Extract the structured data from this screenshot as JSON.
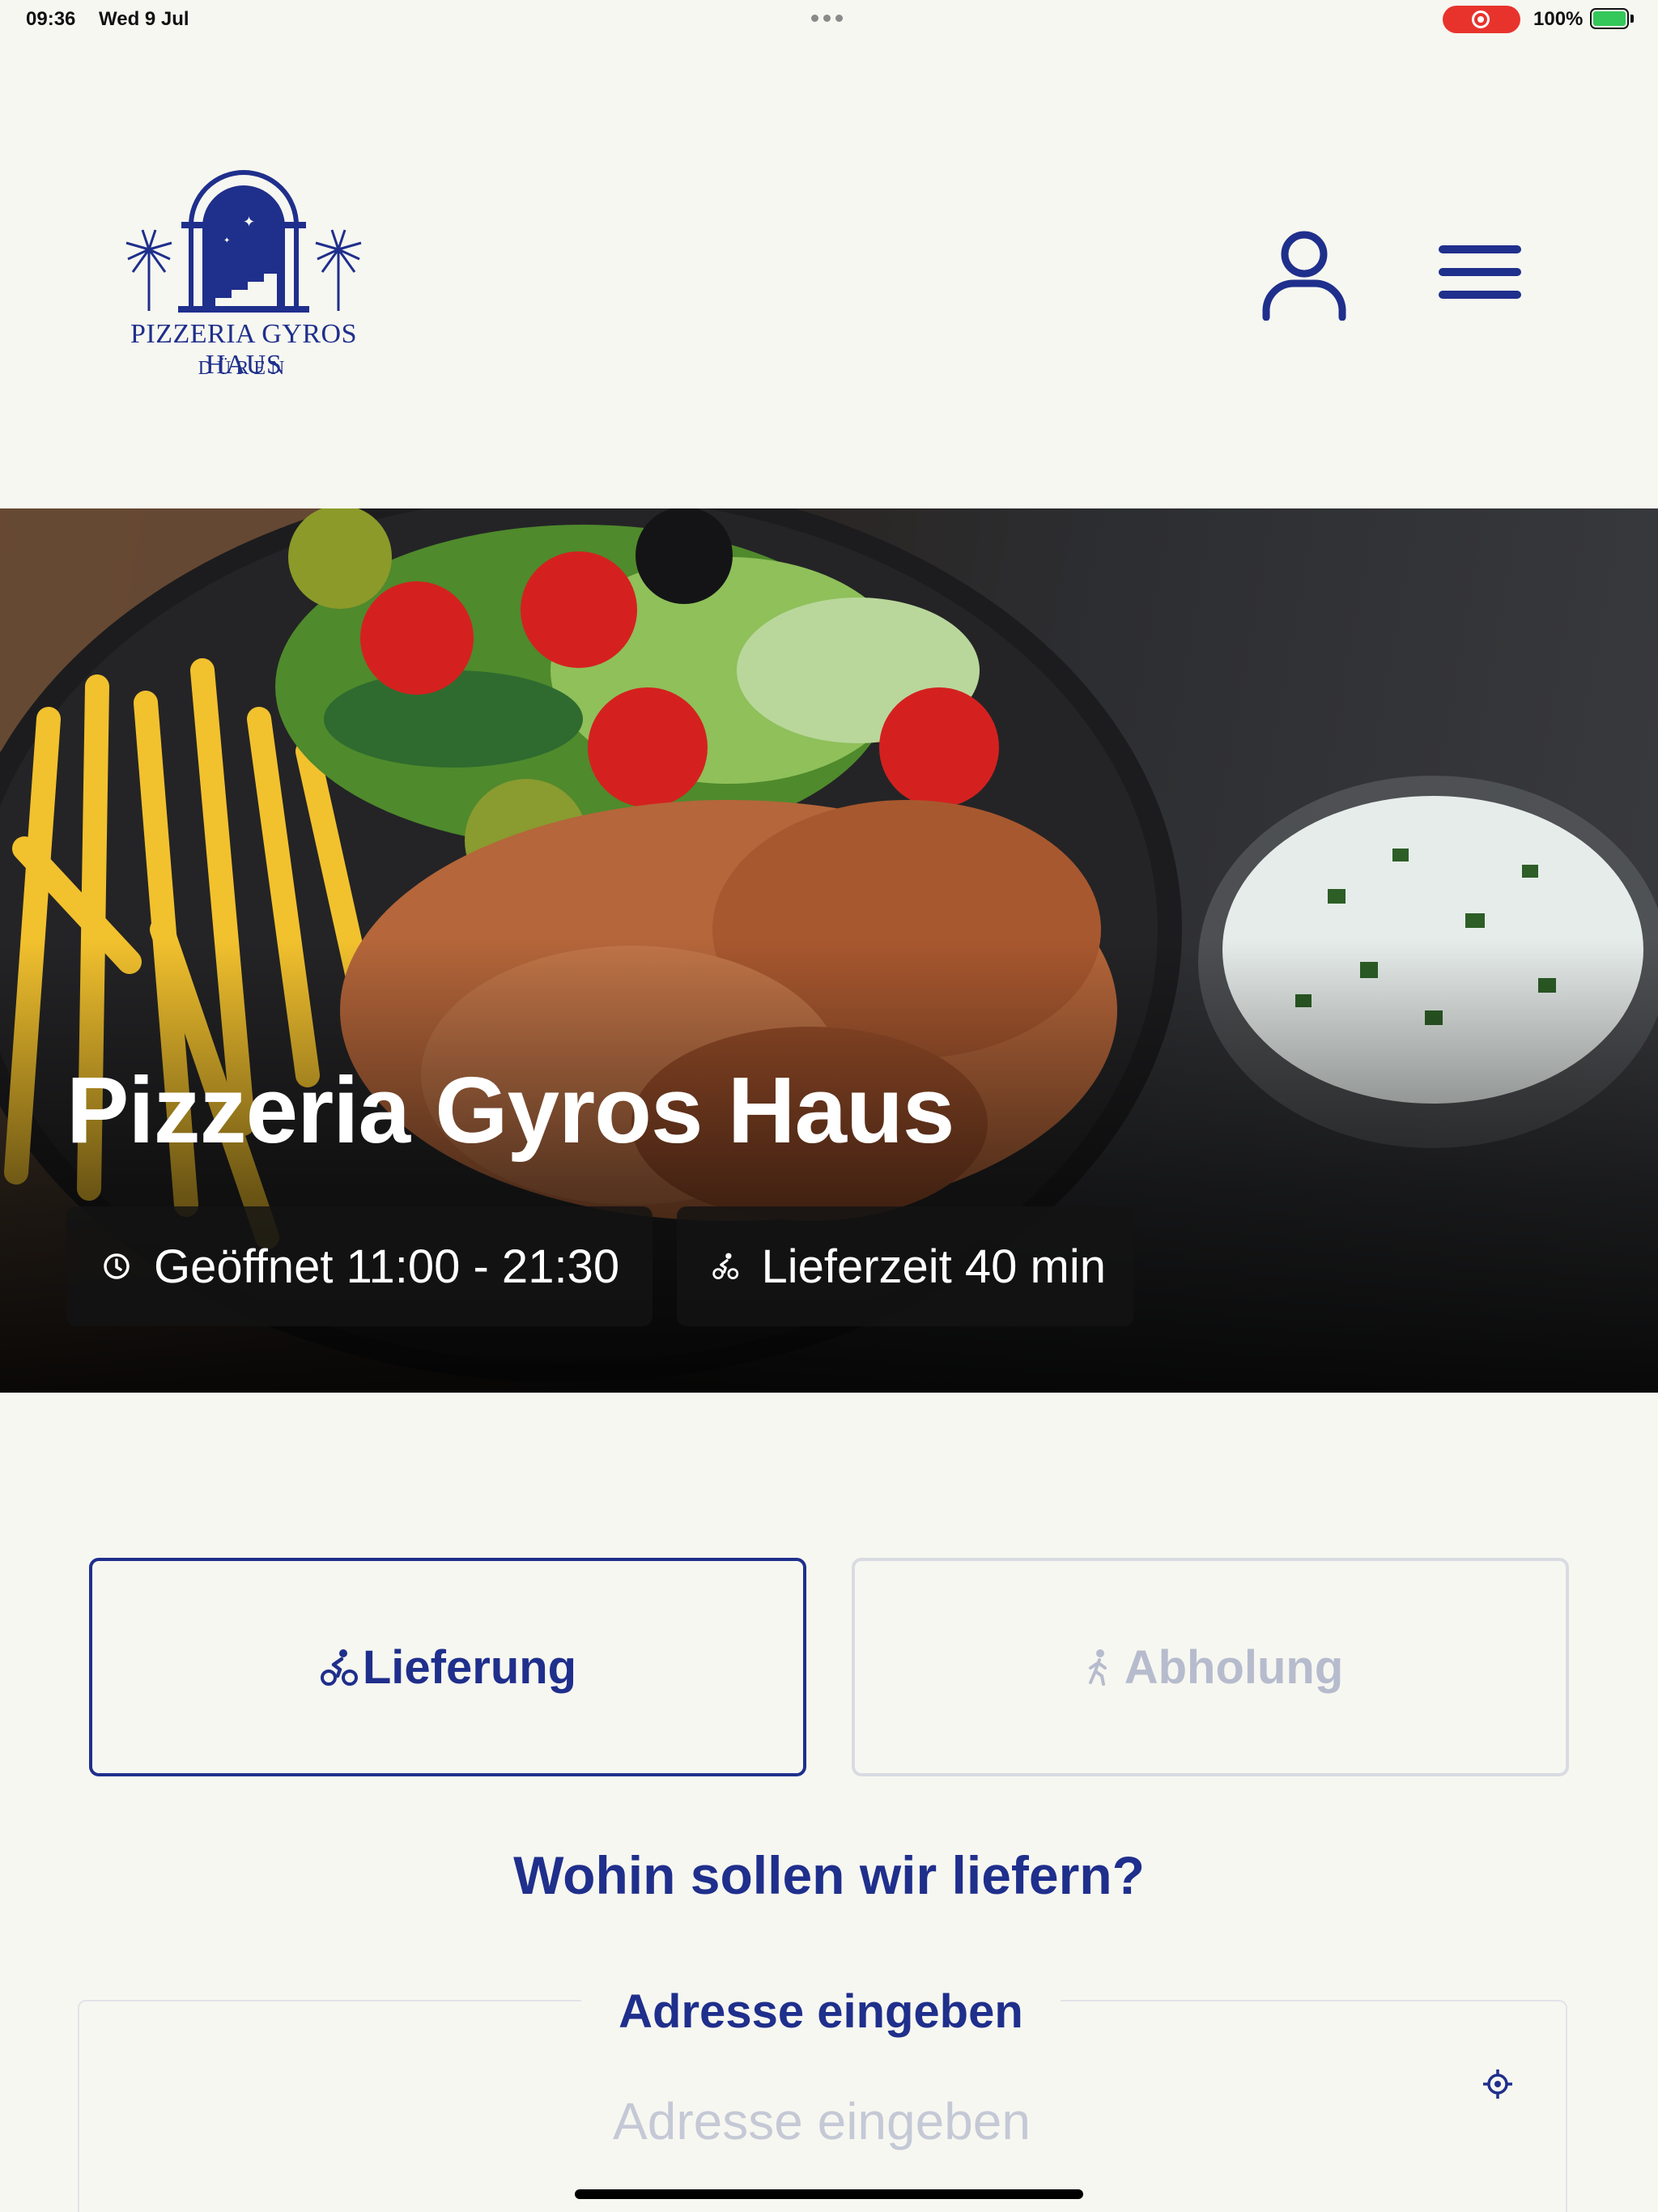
{
  "status_bar": {
    "time": "09:36",
    "date": "Wed 9 Jul",
    "battery": "100%",
    "recording_color": "#e8332d",
    "battery_color": "#34c759"
  },
  "header": {
    "logo_name": "PIZZERIA GYROS HAUS",
    "logo_city": "DÜREN",
    "profile_icon": "person-icon",
    "menu_icon": "hamburger-menu-icon"
  },
  "hero": {
    "title": "Pizzeria Gyros Haus",
    "opening_hours": "Geöffnet 11:00 - 21:30",
    "opening_icon": "clock-icon",
    "delivery_time": "Lieferzeit 40 min",
    "delivery_icon": "bicycle-courier-icon"
  },
  "order_mode": {
    "delivery_label": "Lieferung",
    "delivery_icon": "bicycle-courier-icon",
    "pickup_label": "Abholung",
    "pickup_icon": "walking-person-icon",
    "selected": "Lieferung"
  },
  "address": {
    "question": "Wohin sollen wir liefern?",
    "legend": "Adresse eingeben",
    "placeholder": "Adresse eingeben",
    "value": "",
    "locate_icon": "crosshair-location-icon"
  },
  "colors": {
    "brand": "#1f2f8c",
    "background": "#f7f7f1",
    "inactive": "#b6bccd"
  }
}
